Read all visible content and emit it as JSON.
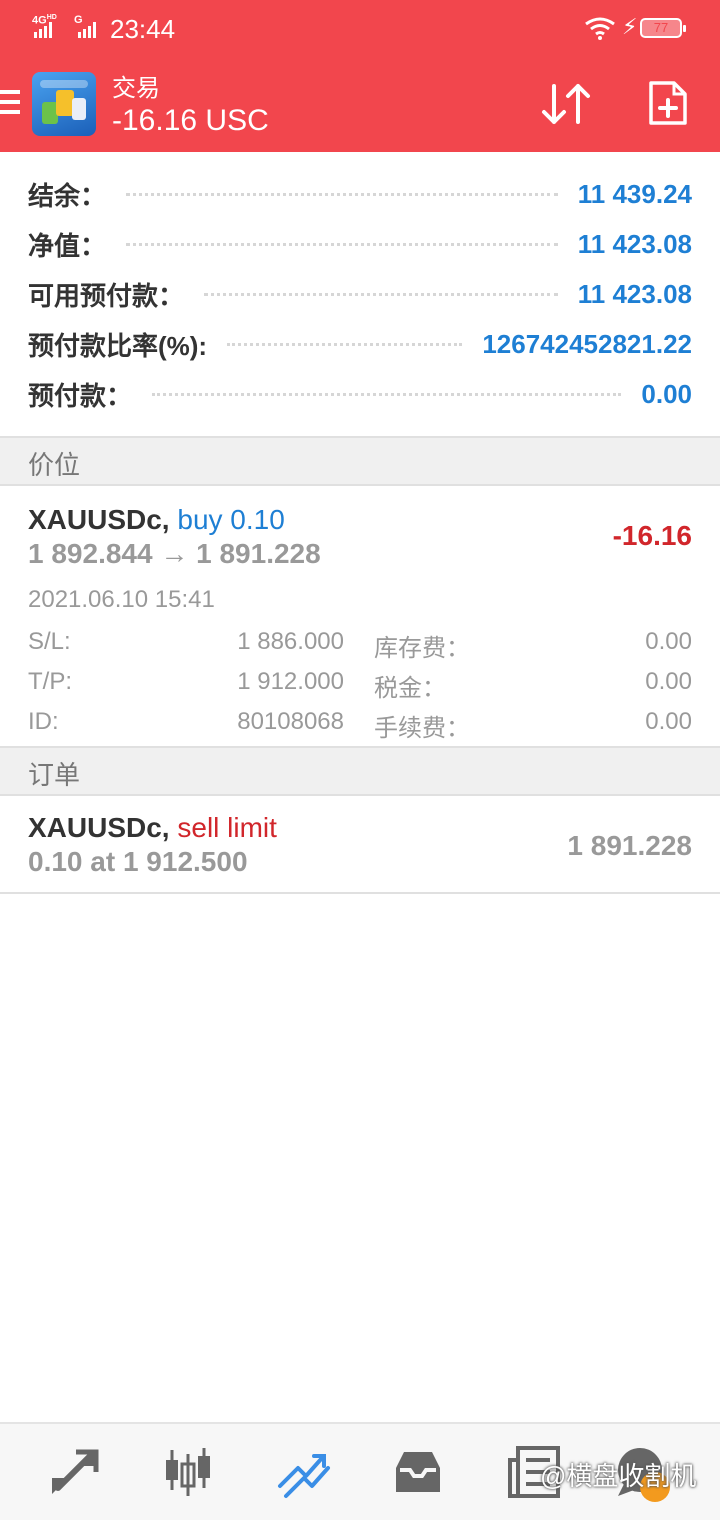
{
  "status_bar": {
    "network1": "4G",
    "network1_sup": "HD",
    "network2": "G",
    "time": "23:44",
    "battery": "77"
  },
  "header": {
    "title": "交易",
    "profit": "-16.16 USC",
    "accent_color": "#f2464d"
  },
  "account": {
    "rows": [
      {
        "label": "结余：",
        "value": "11 439.24"
      },
      {
        "label": "净值：",
        "value": "11 423.08"
      },
      {
        "label": "可用预付款：",
        "value": "11 423.08"
      },
      {
        "label": "预付款比率(%):",
        "value": "126742452821.22"
      },
      {
        "label": "预付款：",
        "value": "0.00"
      }
    ]
  },
  "positions_section": {
    "title": "价位"
  },
  "position": {
    "symbol": "XAUUSDc,",
    "direction": "buy 0.10",
    "prices": "1 892.844 → 1 891.228",
    "profit": "-16.16",
    "time": "2021.06.10 15:41",
    "details": [
      {
        "label": "S/L:",
        "value": "1 886.000",
        "label2": "库存费：",
        "value2": "0.00"
      },
      {
        "label": "T/P:",
        "value": "1 912.000",
        "label2": "税金：",
        "value2": "0.00"
      },
      {
        "label": "ID:",
        "value": "80108068",
        "label2": "手续费：",
        "value2": "0.00"
      }
    ]
  },
  "orders_section": {
    "title": "订单"
  },
  "order": {
    "symbol": "XAUUSDc,",
    "type": "sell limit",
    "volume_price": "0.10 at 1 912.500",
    "current_price": "1 891.228"
  },
  "bottom_nav": {
    "items": [
      "quotes-icon",
      "chart-icon",
      "trade-icon",
      "history-icon",
      "news-icon",
      "chat-icon"
    ],
    "active": "trade-icon"
  },
  "watermark": "@横盘收割机"
}
